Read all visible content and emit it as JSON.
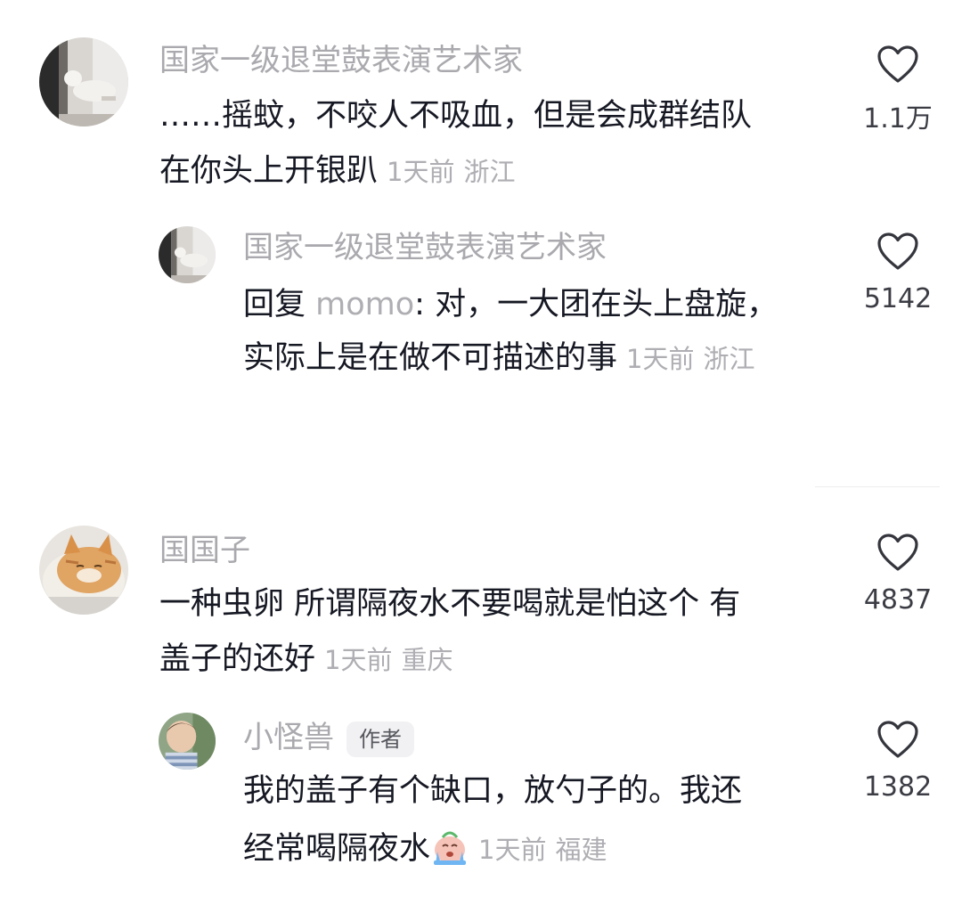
{
  "comments": [
    {
      "username": "国家一级退堂鼓表演艺术家",
      "lines": [
        "……摇蚊，不咬人不吸血，但是会成群结队",
        "在你头上开银趴"
      ],
      "time": "1天前",
      "location": "浙江",
      "likes": "1.1万",
      "avatar_icon": "cat-on-windowsill-avatar"
    },
    {
      "username": "国家一级退堂鼓表演艺术家",
      "reply_prefix": "回复",
      "reply_target": "momo",
      "lines": [
        "对，一大团在头上盘旋，",
        "实际上是在做不可描述的事"
      ],
      "time": "1天前",
      "location": "浙江",
      "likes": "5142",
      "avatar_icon": "cat-on-windowsill-avatar"
    },
    {
      "username": "国国子",
      "lines": [
        "一种虫卵 所谓隔夜水不要喝就是怕这个 有",
        "盖子的还好"
      ],
      "time": "1天前",
      "location": "重庆",
      "likes": "4837",
      "avatar_icon": "orange-cat-avatar"
    },
    {
      "username": "小怪兽",
      "badge": "作者",
      "lines": [
        "我的盖子有个缺口，放勺子的。我还",
        "经常喝隔夜水"
      ],
      "emoji": "crying-face-emoji",
      "time": "1天前",
      "location": "福建",
      "likes": "1382",
      "avatar_icon": "child-photo-avatar"
    }
  ],
  "colors": {
    "text": "#161823",
    "secondary": "#a9a9ae",
    "like_count": "#3b3c44"
  }
}
